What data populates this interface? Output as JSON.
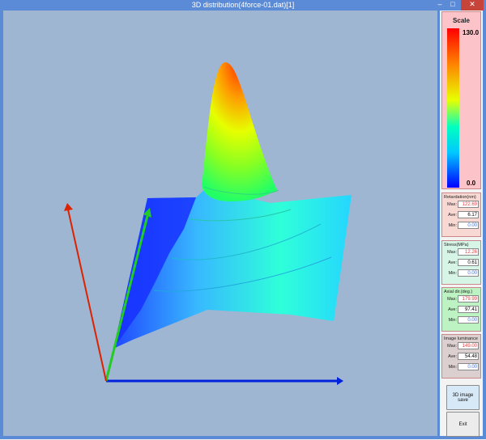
{
  "window": {
    "title": "3D distribution(4force-01.dat)[1]",
    "minimize": "–",
    "maximize": "□",
    "close": "✕"
  },
  "scale": {
    "title": "Scale",
    "max": "130.0",
    "min": "0.0"
  },
  "labels": {
    "max": "Max:",
    "ave": "Ave:",
    "min": "Min:"
  },
  "stats": {
    "retardation": {
      "title": "Retardation(nm)",
      "max": "122.69",
      "ave": "6.17",
      "min": "0.00"
    },
    "stress": {
      "title": "Stress(MPa)",
      "max": "12.26",
      "ave": "0.61",
      "min": "0.00"
    },
    "axial": {
      "title": "Axial dir.(deg.)",
      "max": "179.99",
      "ave": "97.41",
      "min": "0.00"
    },
    "luminance": {
      "title": "Image luminance",
      "max": "149.00",
      "ave": "54.48",
      "min": "0.00"
    }
  },
  "buttons": {
    "save": "3D image save",
    "exit": "Exit"
  },
  "colors": {
    "axis_x": "#0022dd",
    "axis_y": "#22cc22",
    "axis_z": "#dd2200",
    "viewport_bg": "#9fb6d3"
  }
}
